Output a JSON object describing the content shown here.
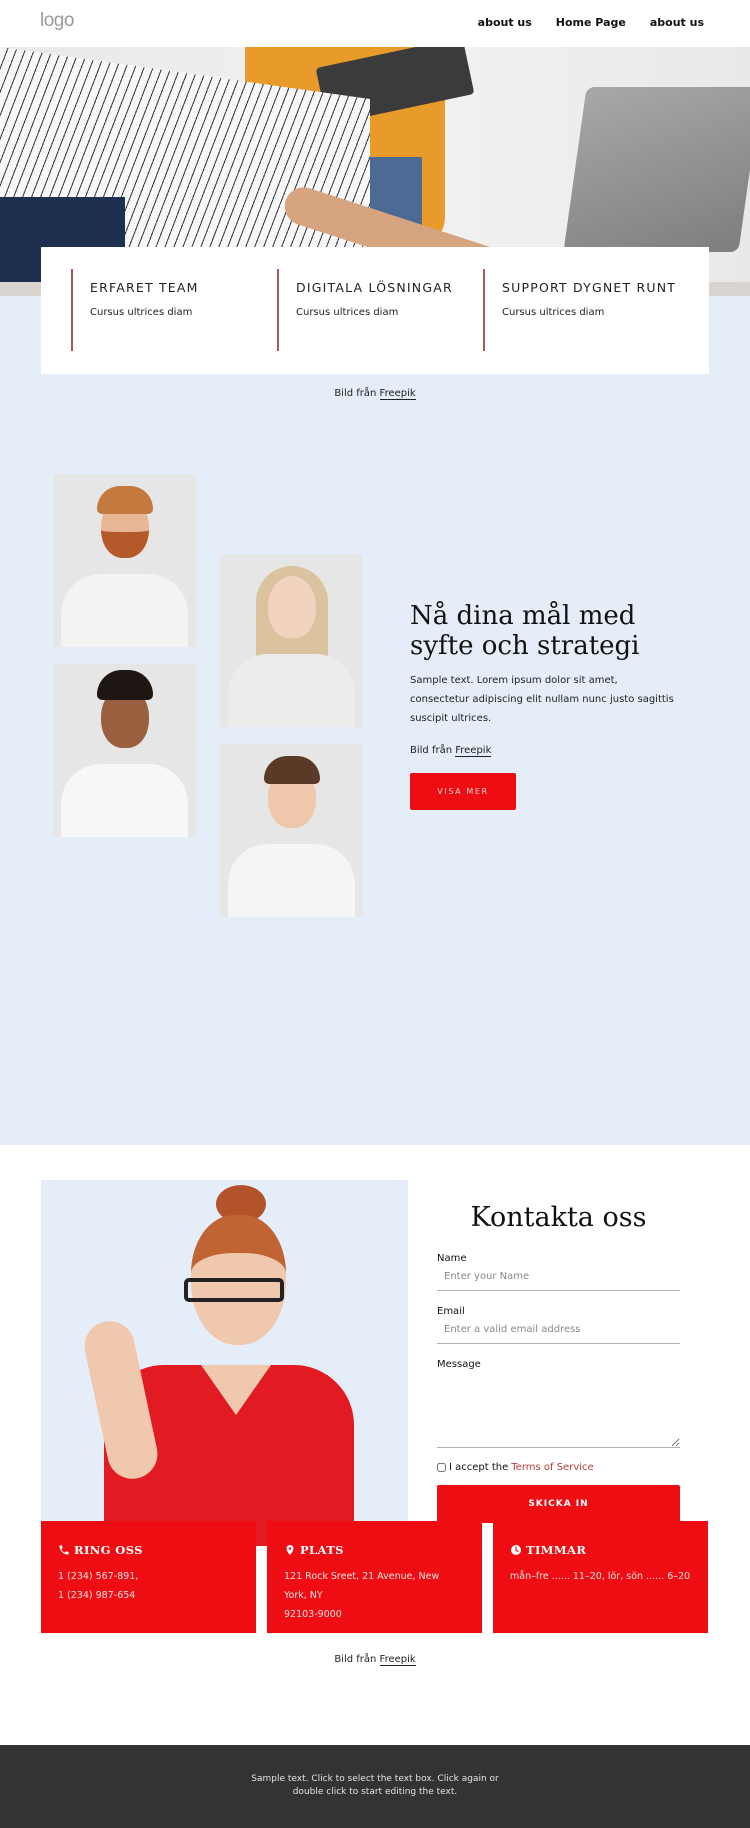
{
  "header": {
    "logo": "logo",
    "nav": [
      {
        "label": "about us"
      },
      {
        "label": "Home Page"
      },
      {
        "label": "about us"
      }
    ]
  },
  "features": [
    {
      "title": "ERFARET TEAM",
      "text": "Cursus ultrices diam"
    },
    {
      "title": "DIGITALA LÖSNINGAR",
      "text": "Cursus ultrices diam"
    },
    {
      "title": "SUPPORT DYGNET RUNT",
      "text": "Cursus ultrices diam"
    }
  ],
  "credit": {
    "prefix": "Bild från",
    "link": "Freepik"
  },
  "team": {
    "heading": "Nå dina mål med syfte och strategi",
    "body": "Sample text. Lorem ipsum dolor sit amet, consectetur adipiscing elit nullam nunc justo sagittis suscipit ultrices.",
    "credit_prefix": "Bild från",
    "credit_link": "Freepik",
    "button": "VISA MER"
  },
  "contact": {
    "title": "Kontakta oss",
    "name_label": "Name",
    "name_placeholder": "Enter your Name",
    "email_label": "Email",
    "email_placeholder": "Enter a valid email address",
    "message_label": "Message",
    "accept_prefix": "I accept the",
    "accept_link": "Terms of Service",
    "submit": "SKICKA IN"
  },
  "info": [
    {
      "icon": "phone-icon",
      "title": "RING OSS",
      "lines": [
        "1 (234) 567-891,",
        "1 (234) 987-654"
      ]
    },
    {
      "icon": "location-pin-icon",
      "title": "PLATS",
      "lines": [
        "121 Rock Sreet, 21 Avenue, New York, NY",
        "92103-9000"
      ]
    },
    {
      "icon": "clock-icon",
      "title": "TIMMAR",
      "lines": [
        "mån–fre ...... 11–20, lör, sön  ...... 6–20"
      ]
    }
  ],
  "footer": {
    "text": "Sample text. Click to select the text box. Click again or double click to start editing the text."
  },
  "colors": {
    "accent_red": "#ed0d13",
    "section_blue": "#e5edf8",
    "feature_divider": "#a8585a",
    "footer_bg": "#333333"
  }
}
